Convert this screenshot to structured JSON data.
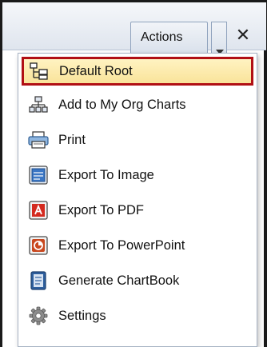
{
  "toolbar": {
    "actions_label": "Actions",
    "close_glyph": "✕"
  },
  "menu": {
    "items": [
      {
        "label": "Default Root",
        "icon": "org-tree-icon"
      },
      {
        "label": "Add to My Org Charts",
        "icon": "org-chart-add-icon"
      },
      {
        "label": "Print",
        "icon": "printer-icon"
      },
      {
        "label": "Export To Image",
        "icon": "image-export-icon"
      },
      {
        "label": "Export To PDF",
        "icon": "pdf-icon"
      },
      {
        "label": "Export To PowerPoint",
        "icon": "powerpoint-icon"
      },
      {
        "label": "Generate ChartBook",
        "icon": "chartbook-icon"
      },
      {
        "label": "Settings",
        "icon": "gear-icon"
      }
    ]
  },
  "colors": {
    "highlight_border": "#b10f14",
    "highlight_fill": "#f9e39a",
    "pdf_red": "#d42a1f",
    "powerpoint_orange": "#c9481f",
    "chartbook_blue": "#2e5f9e"
  }
}
